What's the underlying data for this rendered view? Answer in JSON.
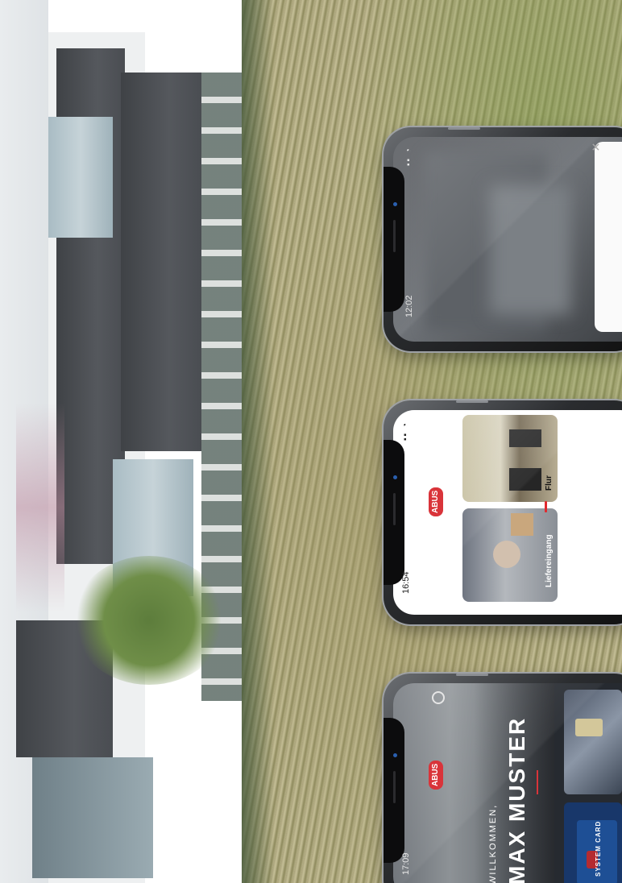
{
  "phones": [
    {
      "id": "phone-1",
      "status_time": "12:02",
      "status_icons": "▪▪ ◔",
      "close_icon": "close-icon"
    },
    {
      "id": "phone-2",
      "status_time": "16:54",
      "status_icons": "▪▪ ◔",
      "brand": "ABUS",
      "cameras": [
        {
          "label": "Flur",
          "status_color": "#e02a2f"
        },
        {
          "label": "Liefereingang"
        }
      ]
    },
    {
      "id": "phone-3",
      "status_time": "17:09",
      "brand": "ABUS",
      "welcome_line": "WILLKOMMEN,",
      "user_name": "MAX MUSTER",
      "settings_icon": "gear-icon",
      "cards": [
        {
          "label": ""
        },
        {
          "label": "SYSTEM CARD"
        }
      ]
    }
  ],
  "colors": {
    "brand_red": "#d9343a",
    "phone_frame": "#2a2c2f"
  }
}
